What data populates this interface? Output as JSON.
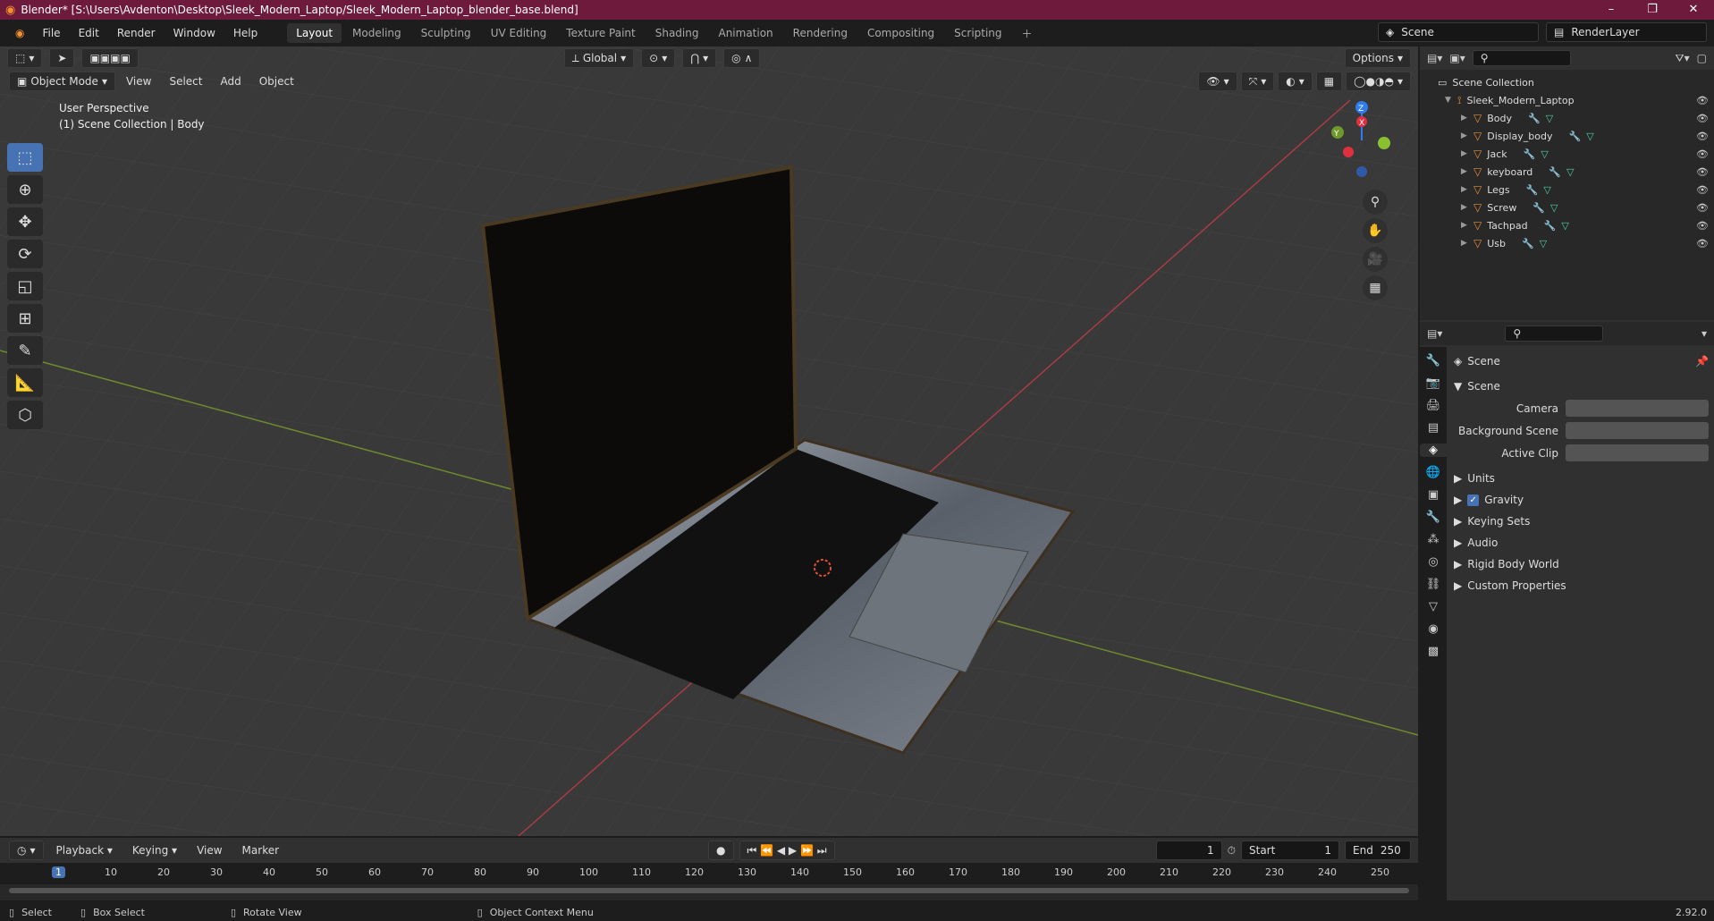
{
  "window": {
    "title": "Blender* [S:\\Users\\Avdenton\\Desktop\\Sleek_Modern_Laptop/Sleek_Modern_Laptop_blender_base.blend]",
    "controls": [
      "–",
      "❐",
      "✕"
    ]
  },
  "menubar": {
    "menus": [
      "File",
      "Edit",
      "Render",
      "Window",
      "Help"
    ],
    "workspaces": [
      "Layout",
      "Modeling",
      "Sculpting",
      "UV Editing",
      "Texture Paint",
      "Shading",
      "Animation",
      "Rendering",
      "Compositing",
      "Scripting"
    ],
    "active_workspace": "Layout",
    "scene": "Scene",
    "view_layer": "RenderLayer"
  },
  "viewport": {
    "transform_orientation": "Global",
    "options_label": "Options",
    "mode": "Object Mode",
    "menus": [
      "View",
      "Select",
      "Add",
      "Object"
    ],
    "info_line1": "User Perspective",
    "info_line2": "(1) Scene Collection | Body",
    "gizmo_axes": {
      "z": "Z",
      "y": "Y",
      "x": "X"
    }
  },
  "outliner": {
    "root": "Scene Collection",
    "collection": "Sleek_Modern_Laptop",
    "objects": [
      {
        "name": "Body"
      },
      {
        "name": "Display_body"
      },
      {
        "name": "Jack"
      },
      {
        "name": "keyboard"
      },
      {
        "name": "Legs"
      },
      {
        "name": "Screw"
      },
      {
        "name": "Tachpad"
      },
      {
        "name": "Usb"
      }
    ]
  },
  "properties": {
    "context": "Scene",
    "panel": "Scene",
    "fields": [
      {
        "label": "Camera"
      },
      {
        "label": "Background Scene"
      },
      {
        "label": "Active Clip"
      }
    ],
    "sections": [
      "Units",
      "Gravity",
      "Keying Sets",
      "Audio",
      "Rigid Body World",
      "Custom Properties"
    ]
  },
  "timeline": {
    "menus": [
      "Playback",
      "Keying",
      "View",
      "Marker"
    ],
    "current_frame": "1",
    "start_label": "Start",
    "start": "1",
    "end_label": "End",
    "end": "250",
    "ruler": [
      "1",
      "10",
      "20",
      "30",
      "40",
      "50",
      "60",
      "70",
      "80",
      "90",
      "100",
      "110",
      "120",
      "130",
      "140",
      "150",
      "160",
      "170",
      "180",
      "190",
      "200",
      "210",
      "220",
      "230",
      "240",
      "250"
    ]
  },
  "statusbar": {
    "select": "Select",
    "box_select": "Box Select",
    "rotate": "Rotate View",
    "context_menu": "Object Context Menu",
    "version": "2.92.0"
  }
}
